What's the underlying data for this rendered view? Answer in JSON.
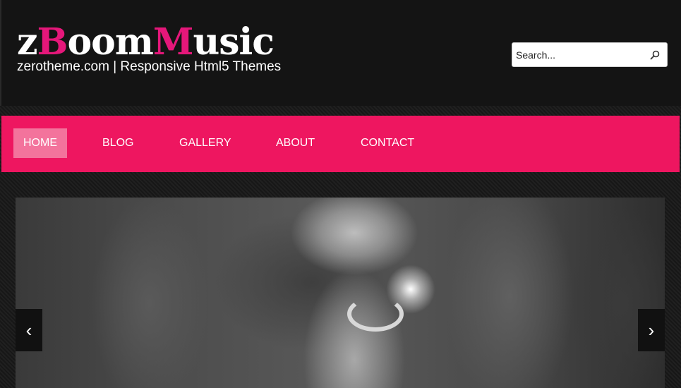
{
  "header": {
    "logo": {
      "part1": "z",
      "part2": "B",
      "part3": "oom",
      "part4": "M",
      "part5": "usic"
    },
    "tagline": "zerotheme.com | Responsive Html5 Themes",
    "search": {
      "placeholder": "Search...",
      "icon": "search-icon"
    }
  },
  "nav": {
    "items": [
      {
        "label": "HOME",
        "active": true
      },
      {
        "label": "BLOG",
        "active": false
      },
      {
        "label": "GALLERY",
        "active": false
      },
      {
        "label": "ABOUT",
        "active": false
      },
      {
        "label": "CONTACT",
        "active": false
      }
    ]
  },
  "slider": {
    "prev_icon": "‹",
    "next_icon": "›"
  },
  "colors": {
    "accent": "#ee1660",
    "active_nav": "#f3739c",
    "logo_pink": "#e5177a",
    "header_bg": "#141414"
  }
}
